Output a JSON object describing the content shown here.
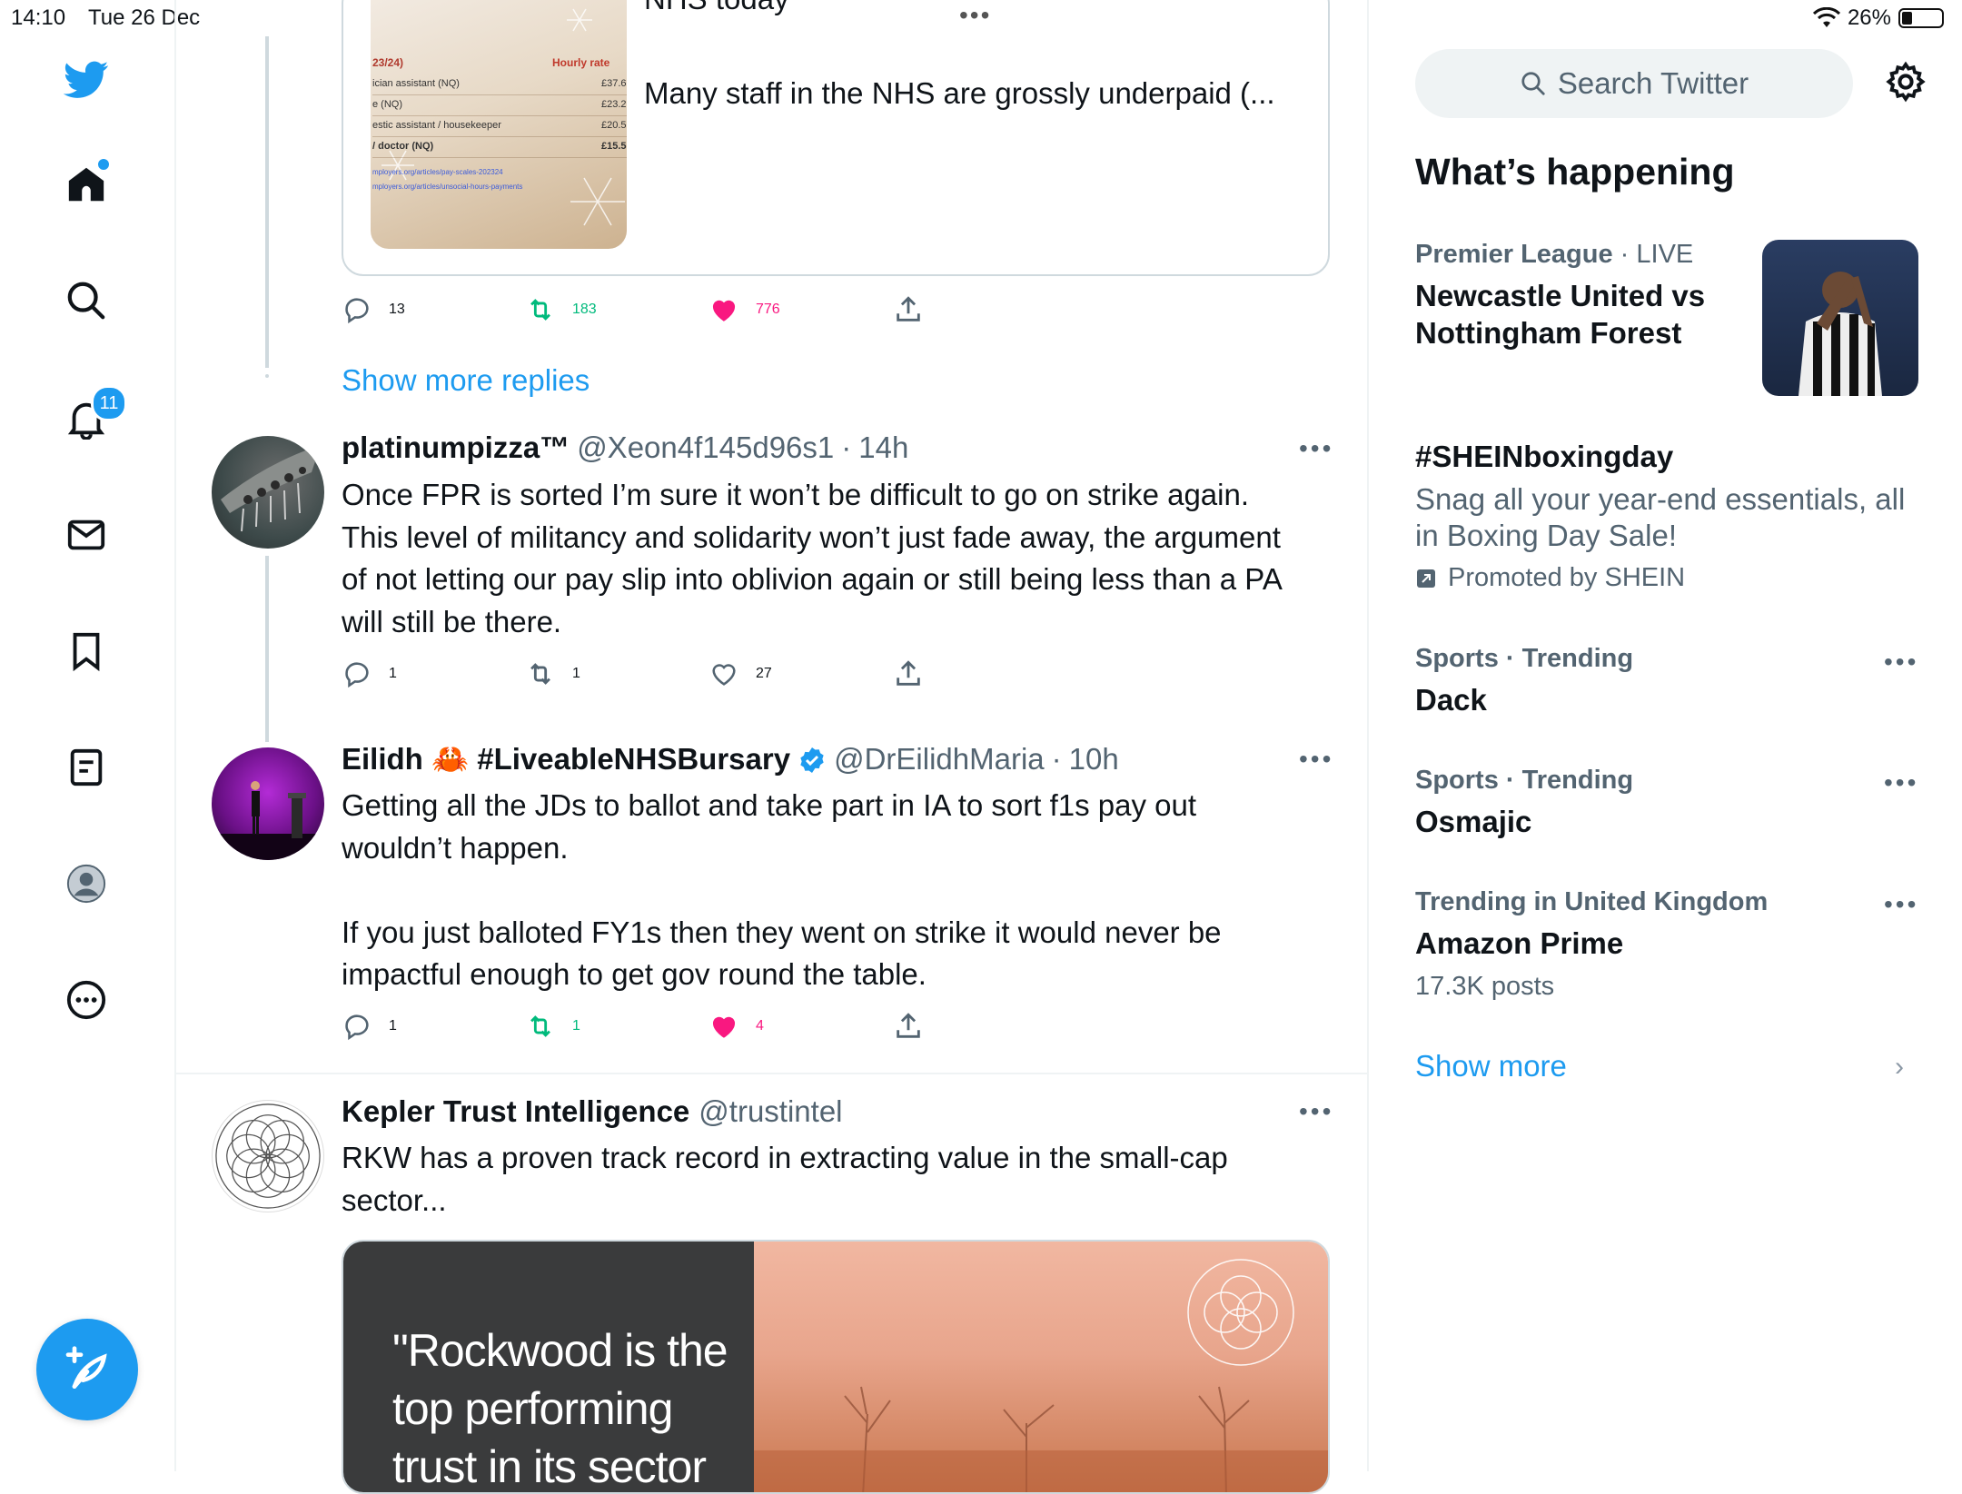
{
  "status_bar": {
    "time": "14:10",
    "date": "Tue 26 Dec",
    "battery_percent": "26%",
    "battery_level": 0.26
  },
  "nav": {
    "notifications_badge": "11",
    "items": [
      "twitter-logo-icon",
      "home-icon",
      "search-icon",
      "notifications-icon",
      "messages-icon",
      "bookmarks-icon",
      "lists-icon",
      "profile-icon",
      "more-icon"
    ]
  },
  "quoted_card": {
    "title_partial": "NHS today",
    "text": "Many staff in the NHS are grossly underpaid (...",
    "table": {
      "header_left": "23/24)",
      "header_right": "Hourly rate",
      "rows": [
        {
          "role": "ician assistant (NQ)",
          "rate": "£37.6"
        },
        {
          "role": "e (NQ)",
          "rate": "£23.2"
        },
        {
          "role": "estic assistant / housekeeper",
          "rate": "£20.5"
        },
        {
          "role": "/ doctor (NQ)",
          "rate": "£15.5"
        }
      ],
      "links": [
        "mployers.org/articles/pay-scales-202324",
        "mployers.org/articles/unsocial-hours-payments"
      ]
    }
  },
  "first_tweet_actions": {
    "replies": "13",
    "retweets": "183",
    "likes": "776"
  },
  "show_more_replies": "Show more replies",
  "tweets": [
    {
      "name": "platinumpizza™",
      "handle": "@Xeon4f145d96s1",
      "sep": "·",
      "time": "14h",
      "lines": [
        "Once FPR is sorted I’m sure it won’t be difficult to go on strike again.",
        "This level of militancy and solidarity won’t just fade away, the argument",
        "of not letting our pay slip into oblivion again or still being less than a PA",
        "will still be there."
      ],
      "replies": "1",
      "retweets": "1",
      "likes": "27"
    },
    {
      "name": "Eilidh 🦀 #LiveableNHSBursary",
      "handle": "@DrEilidhMaria",
      "sep": "·",
      "time": "10h",
      "lines": [
        "Getting all the JDs to ballot and take part in IA to sort f1s pay out",
        "wouldn’t happen.",
        "",
        "If you just balloted FY1s then they went on strike it would never be",
        "impactful enough to get gov round the table."
      ],
      "replies": "1",
      "retweets": "1",
      "likes": "4"
    },
    {
      "name": "Kepler Trust Intelligence",
      "handle": "@trustintel",
      "lines": [
        "RKW has a proven track record in extracting value in the small-cap",
        "sector..."
      ],
      "card_quote": [
        "\"Rockwood is the",
        "top performing",
        "trust in its sector"
      ]
    }
  ],
  "sidebar": {
    "search_placeholder": "Search Twitter",
    "whats_happening": "What’s happening",
    "trends": [
      {
        "meta_main": "Premier League",
        "meta_sep": " · ",
        "meta_extra": "LIVE",
        "title_lines": [
          "Newcastle United vs",
          "Nottingham Forest"
        ]
      },
      {
        "title": "#SHEINboxingday",
        "desc_lines": [
          "Snag all your year-end essentials, all",
          "in Boxing Day Sale!"
        ],
        "promoted": "Promoted by SHEIN"
      },
      {
        "meta": "Sports · Trending",
        "title": "Dack"
      },
      {
        "meta": "Sports · Trending",
        "title": "Osmajic"
      },
      {
        "meta": "Trending in United Kingdom",
        "title": "Amazon Prime",
        "posts": "17.3K posts"
      }
    ],
    "show_more": "Show more"
  },
  "colors": {
    "accent": "#1d9bf0",
    "like": "#f91880",
    "retweet": "#00ba7c",
    "text": "#0f1419",
    "muted": "#536471"
  }
}
